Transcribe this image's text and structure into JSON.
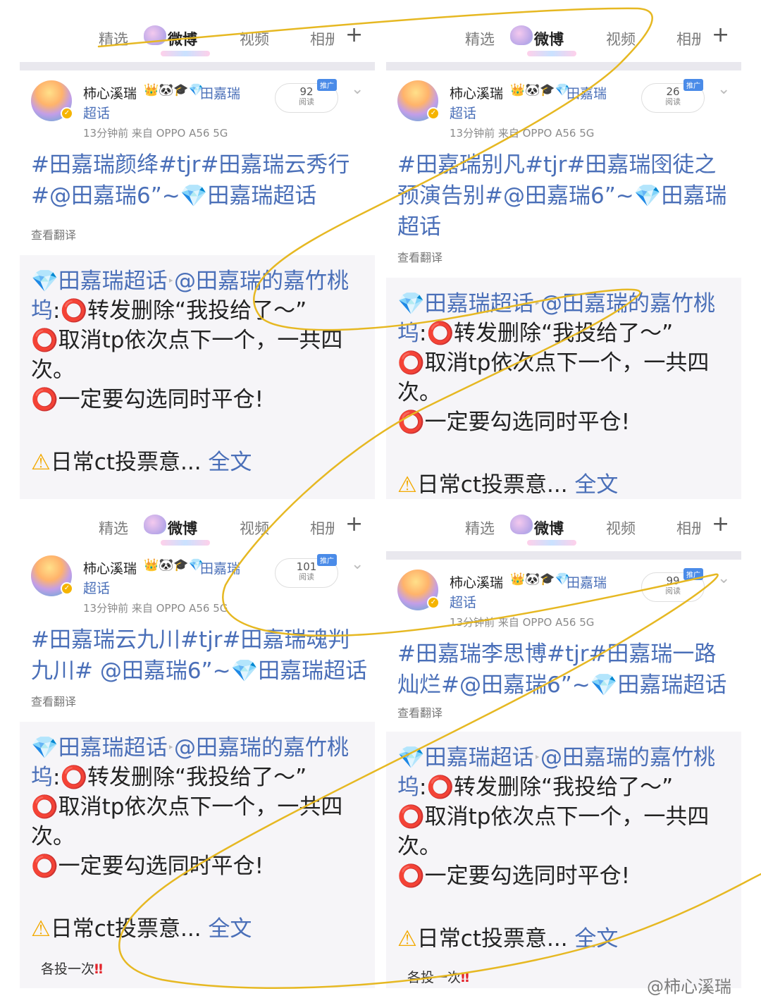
{
  "nav": {
    "tab1": "精选",
    "tab2": "微博",
    "tab3": "视频",
    "tab4": "相册",
    "plus": "+"
  },
  "common": {
    "username": "柿心溪瑞",
    "badges": "👑🐼🎓💎",
    "topic_link_a": "田嘉瑞",
    "topic_link_b": "超话",
    "time_source": "13分钟前   来自 OPPO A56 5G",
    "read_label": "阅读",
    "promo": "推广",
    "translate": "查看翻译",
    "repost_topic": "💎田嘉瑞超话",
    "repost_arrow": "‣",
    "repost_at": "@田嘉瑞的嘉竹桃坞",
    "repost_l1": ":⭕转发删除“我投给了～”",
    "repost_l2": "⭕取消tp依次点下一个，一共四次。",
    "repost_l3": "⭕一定要勾选同时平仓!",
    "warn_icon": "⚠",
    "warn_text": "日常ct投票意...",
    "full_text": "全文",
    "footer": "各投一次",
    "footer_bang": "‼"
  },
  "posts": [
    {
      "reads": "92",
      "title": "#田嘉瑞颜绛#tjr#田嘉瑞云秀行#@田嘉瑞6”~💎田嘉瑞超话"
    },
    {
      "reads": "26",
      "title": "#田嘉瑞别凡#tjr#田嘉瑞囹徒之预演告别#@田嘉瑞6”~💎田嘉瑞超话"
    },
    {
      "reads": "101",
      "title": "#田嘉瑞云九川#tjr#田嘉瑞魂判九川# @田嘉瑞6”~💎田嘉瑞超话"
    },
    {
      "reads": "99",
      "title": "#田嘉瑞李思博#tjr#田嘉瑞一路灿烂#@田嘉瑞6”~💎田嘉瑞超话"
    }
  ],
  "watermark": "@柿心溪瑞",
  "colors": {
    "link": "#4a6fb8",
    "scribble": "#e6b822",
    "alert": "#e4242b",
    "promo": "#4a8be8"
  }
}
